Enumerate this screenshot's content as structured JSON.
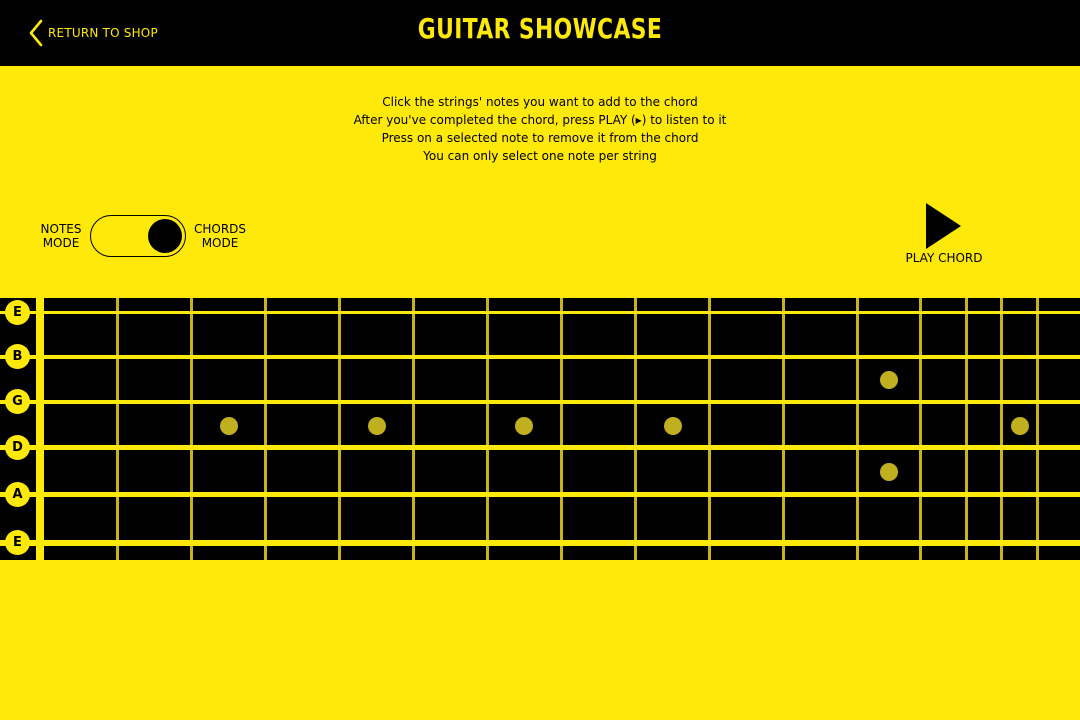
{
  "header": {
    "back_label": "RETURN TO SHOP",
    "title": "GUITAR SHOWCASE",
    "back_icon": "chevron-left-icon"
  },
  "instructions": {
    "line1": "Click the strings' notes you want to add to the chord",
    "line2": "After you've completed the chord, press PLAY (▸) to listen to it",
    "line3": "Press on a selected note to remove it from the chord",
    "line4": "You can only select one note per string"
  },
  "mode_toggle": {
    "left_label_1": "NOTES",
    "left_label_2": "MODE",
    "right_label_1": "CHORDS",
    "right_label_2": "MODE",
    "selected": "CHORDS MODE"
  },
  "play": {
    "label": "PLAY CHORD",
    "icon": "play-icon"
  },
  "strings": [
    "E",
    "B",
    "G",
    "D",
    "A",
    "E"
  ],
  "colors": {
    "accent": "#FFE90A",
    "background": "#000000",
    "fret": "#C9B418",
    "inlay": "#C0AF1E"
  }
}
